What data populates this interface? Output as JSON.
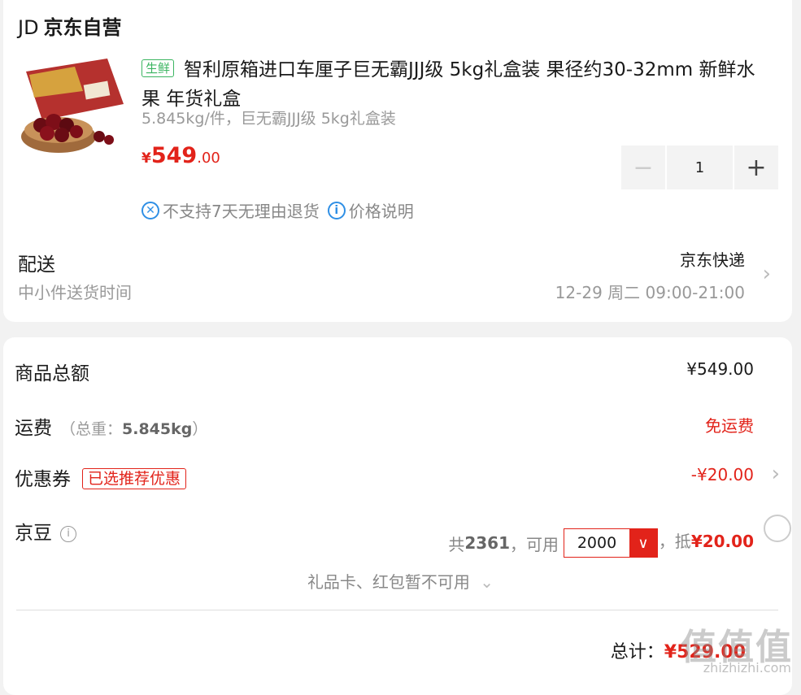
{
  "header": {
    "logo_text": "JD",
    "shop_name": "京东自营"
  },
  "product": {
    "tag": "生鲜",
    "title": "智利原箱进口车厘子巨无霸JJJ级 5kg礼盒装 果径约30-32mm 新鲜水果 年货礼盒",
    "spec": "5.845kg/件，巨无霸JJJ级 5kg礼盒装",
    "price_symbol": "¥",
    "price_int": "549",
    "price_dec": ".00",
    "quantity": "1",
    "notice_no_return": "不支持7天无理由退货",
    "notice_price": "价格说明",
    "image_icon": "cherries-gift-box"
  },
  "shipping": {
    "label": "配送",
    "sub_label": "中小件送货时间",
    "method": "京东快递",
    "time": "12-29 周二 09:00-21:00"
  },
  "summary": {
    "total_label": "商品总额",
    "total_value": "¥549.00",
    "freight_label": "运费",
    "weight_prefix": "（总重：",
    "weight_value": "5.845kg",
    "weight_suffix": "）",
    "freight_value": "免运费",
    "coupon_label": "优惠券",
    "coupon_tag": "已选推荐优惠",
    "coupon_value": "-¥20.00",
    "bean_label": "京豆",
    "bean_total_prefix": "共",
    "bean_total": "2361",
    "bean_usable": "，可用",
    "bean_select_value": "2000",
    "bean_deduct_prefix": "，抵",
    "bean_deduct_value": "¥20.00",
    "gift_text": "礼品卡、红包暂不可用",
    "grand_label": "总计：",
    "grand_value": "¥529.00"
  },
  "watermark": {
    "text": "值值值",
    "url": "zhizhizhi.com"
  },
  "colors": {
    "accent": "#e2231a",
    "fresh": "#3bb561",
    "info": "#2f8fe5"
  }
}
